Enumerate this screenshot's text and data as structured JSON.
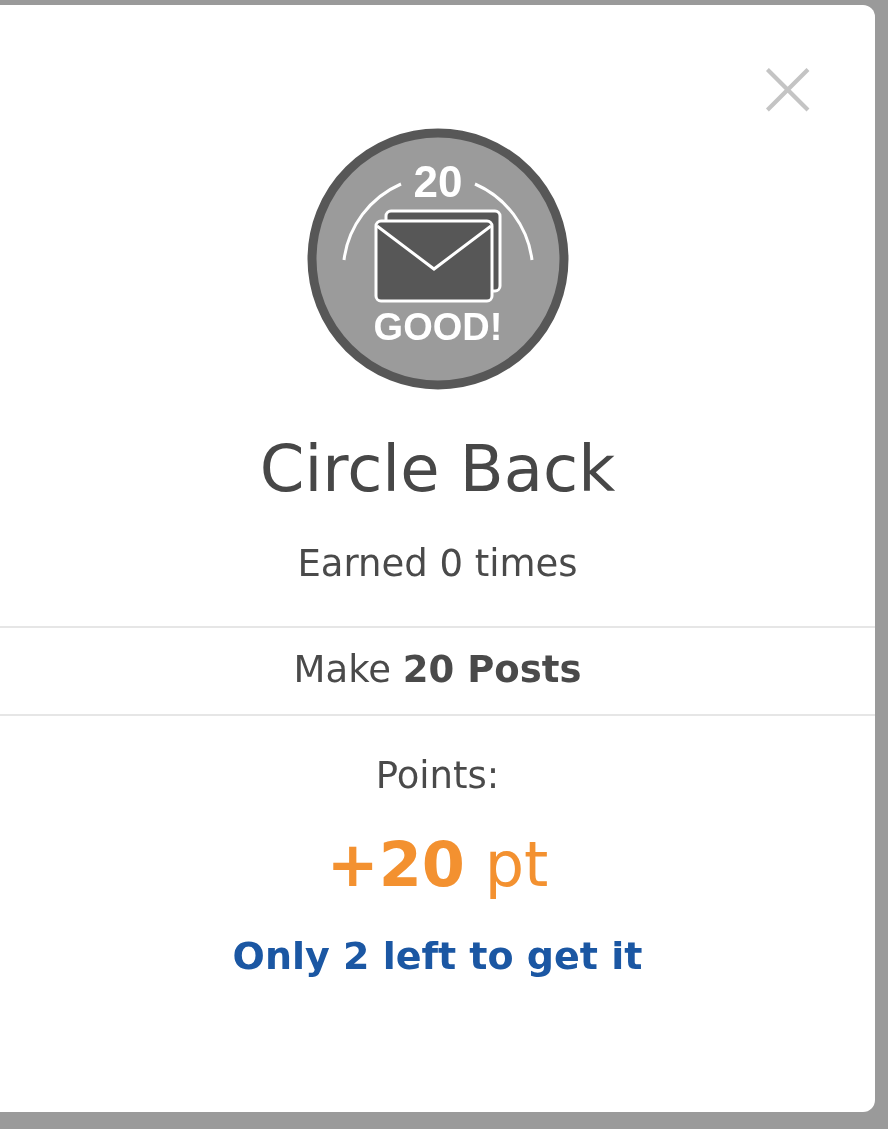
{
  "dialog": {
    "close_label": "×",
    "badge": {
      "count": "20",
      "label": "GOOD!"
    },
    "title": "Circle Back",
    "earned": "Earned 0 times",
    "requirement": "Make **20 Posts**",
    "points_label": "Points:",
    "points_value": "**+20** pt",
    "remaining": "Only 2 left to get it"
  }
}
